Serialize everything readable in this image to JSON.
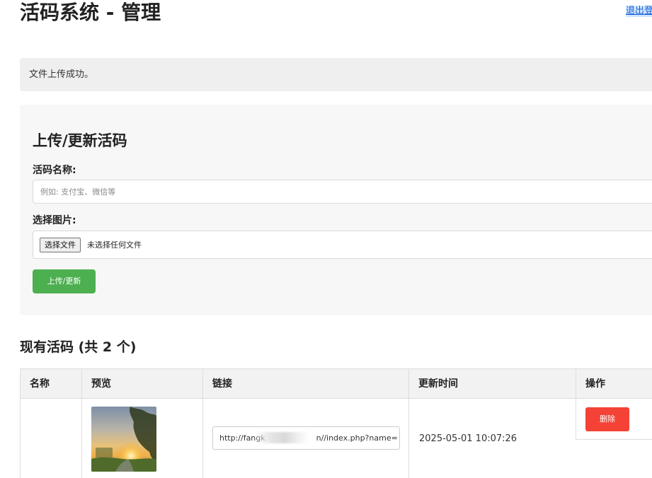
{
  "header": {
    "title": "活码系统 - 管理",
    "logout_label": "退出登录"
  },
  "notice": {
    "message": "文件上传成功。"
  },
  "upload_form": {
    "title": "上传/更新活码",
    "name_label": "活码名称:",
    "name_placeholder": "例如: 支付宝、微信等",
    "name_value": "",
    "image_label": "选择图片:",
    "file_button_label": "选择文件",
    "file_status": "未选择任何文件",
    "submit_label": "上传/更新",
    "submit_color": "#4caf50"
  },
  "codes_list": {
    "title": "现有活码 (共 2 个)",
    "columns": [
      "名称",
      "预览",
      "链接",
      "更新时间",
      "操作"
    ],
    "rows": [
      {
        "name": "",
        "link": "http://fangk",
        "link_tail": "n//index.php?name=",
        "updated": "2025-05-01 10:07:26",
        "action_label": "删除",
        "action_color": "#f44336"
      }
    ]
  }
}
